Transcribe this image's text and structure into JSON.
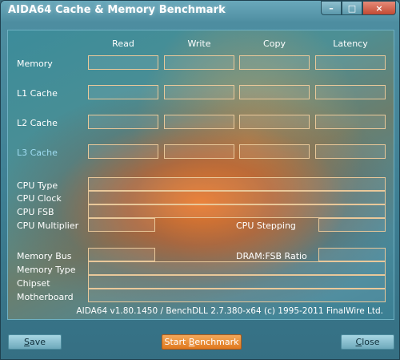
{
  "window": {
    "title": "AIDA64 Cache & Memory Benchmark",
    "minimize_glyph": "–",
    "maximize_glyph": "□",
    "close_glyph": "×"
  },
  "columns": [
    "Read",
    "Write",
    "Copy",
    "Latency"
  ],
  "bench_rows": [
    {
      "label": "Memory",
      "highlight": false,
      "values": [
        "",
        "",
        "",
        ""
      ]
    },
    {
      "label": "L1 Cache",
      "highlight": false,
      "values": [
        "",
        "",
        "",
        ""
      ]
    },
    {
      "label": "L2 Cache",
      "highlight": false,
      "values": [
        "",
        "",
        "",
        ""
      ]
    },
    {
      "label": "L3 Cache",
      "highlight": true,
      "values": [
        "",
        "",
        "",
        ""
      ]
    }
  ],
  "info": {
    "cpu_type": {
      "label": "CPU Type",
      "value": ""
    },
    "cpu_clock": {
      "label": "CPU Clock",
      "value": ""
    },
    "cpu_fsb": {
      "label": "CPU FSB",
      "value": ""
    },
    "cpu_multiplier": {
      "label": "CPU Multiplier",
      "value": ""
    },
    "cpu_stepping": {
      "label": "CPU Stepping",
      "value": ""
    },
    "memory_bus": {
      "label": "Memory Bus",
      "value": ""
    },
    "dram_fsb_ratio": {
      "label": "DRAM:FSB Ratio",
      "value": ""
    },
    "memory_type": {
      "label": "Memory Type",
      "value": ""
    },
    "chipset": {
      "label": "Chipset",
      "value": ""
    },
    "motherboard": {
      "label": "Motherboard",
      "value": ""
    }
  },
  "footer": {
    "version_text": "AIDA64 v1.80.1450 / BenchDLL 2.7.380-x64  (c) 1995-2011 FinalWire Ltd."
  },
  "buttons": {
    "save": {
      "hot": "S",
      "rest": "ave"
    },
    "start": {
      "pre": "Start ",
      "hot": "B",
      "rest": "enchmark"
    },
    "close": {
      "hot": "C",
      "rest": "lose"
    }
  },
  "colors": {
    "panel_border": "#6fb1c3",
    "field_border": "#e9c89a",
    "accent_orange": "#e0791f",
    "highlight_label": "#9fdcf2"
  }
}
